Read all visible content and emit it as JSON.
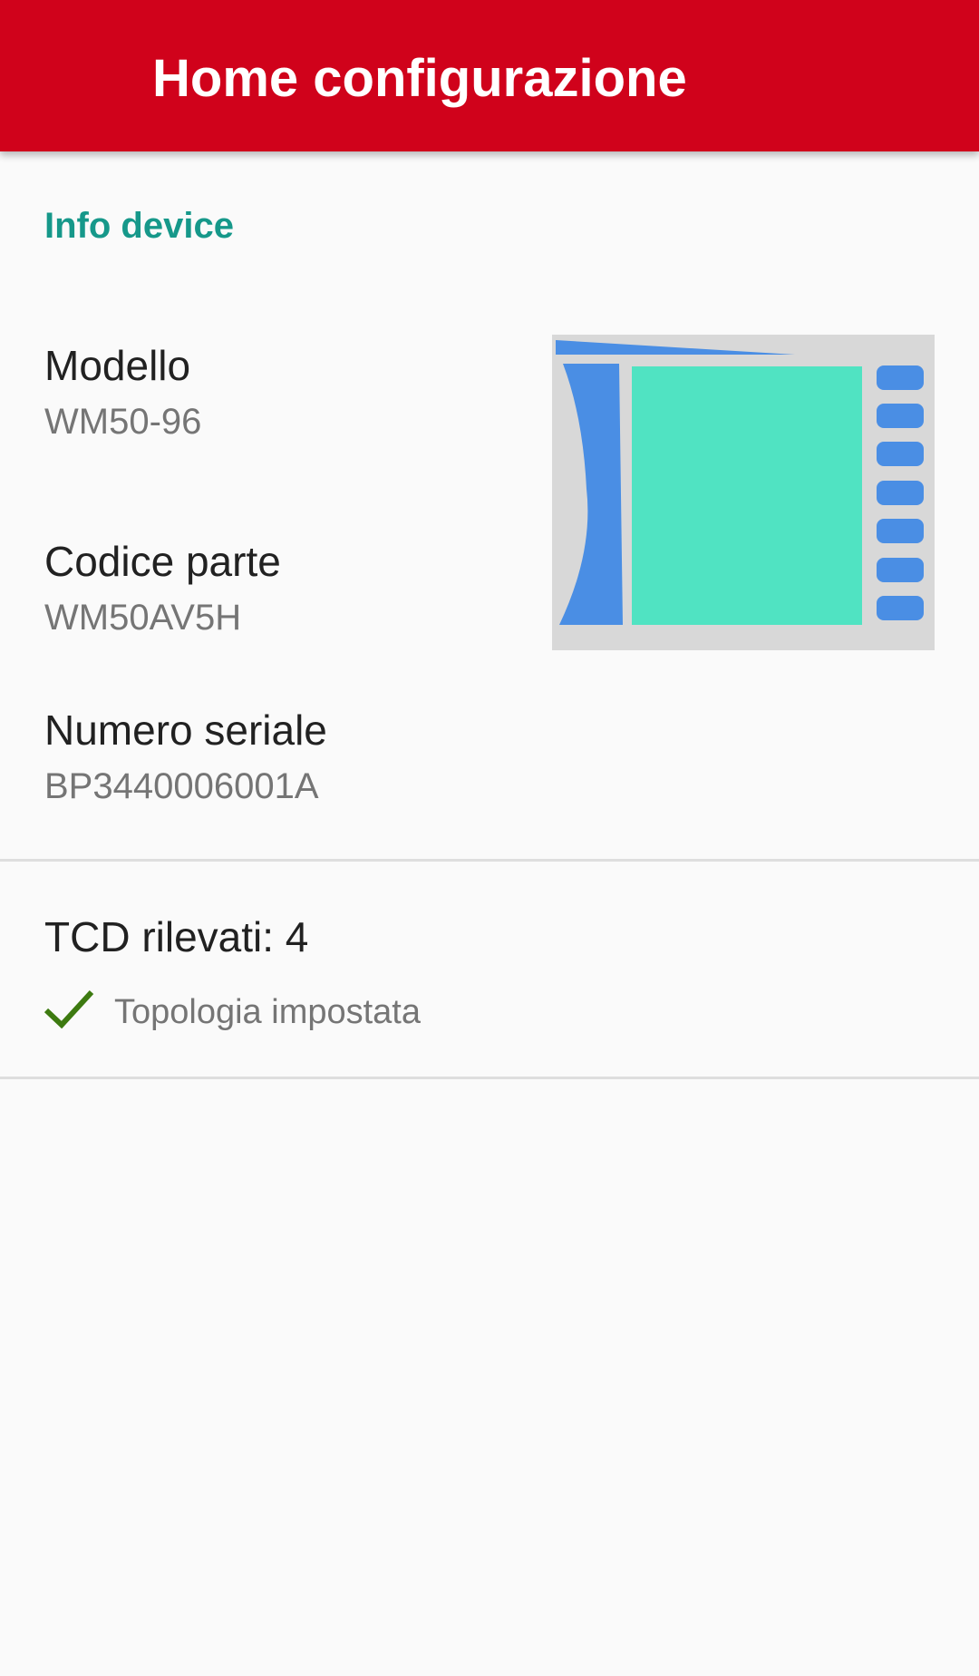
{
  "app_bar": {
    "title": "Home configurazione",
    "color": "#d0021b"
  },
  "info_device": {
    "section_title": "Info device",
    "fields": [
      {
        "label": "Modello",
        "value": "WM50-96"
      },
      {
        "label": "Codice parte",
        "value": "WM50AV5H"
      },
      {
        "label": "Numero seriale",
        "value": "BP3440006001A"
      }
    ],
    "image": "device-wm50-illustration"
  },
  "tcd": {
    "label": "TCD rilevati: 4",
    "status_icon": "check-icon",
    "status_text": "Topologia impostata"
  },
  "colors": {
    "accent": "#16988a",
    "check": "#3d7a10",
    "device_panel": "#d8d8d8",
    "device_blue": "#4a8ee4",
    "device_screen": "#50e3c2"
  }
}
